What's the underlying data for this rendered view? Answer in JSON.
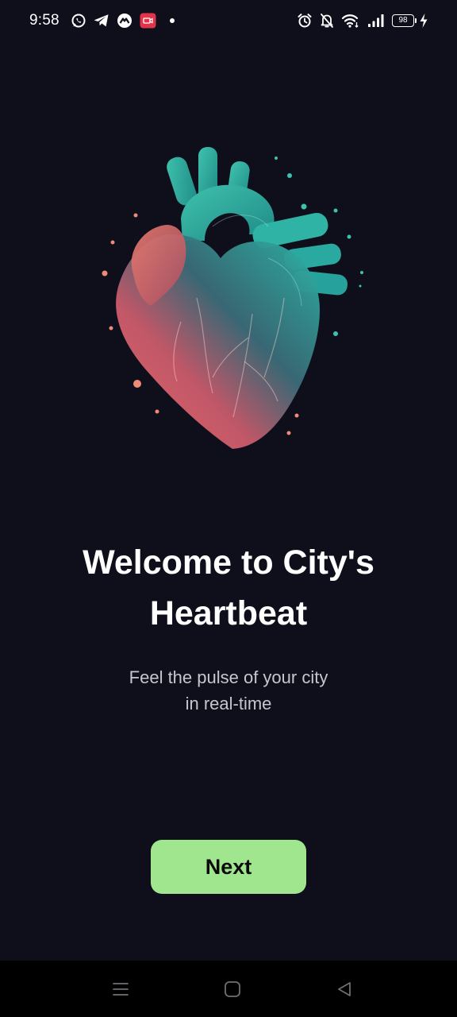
{
  "status_bar": {
    "time": "9:58",
    "battery_level": "98",
    "left_icons": [
      "whatsapp-icon",
      "telegram-icon",
      "game-icon",
      "screen-record-icon",
      "notification-dot-icon"
    ],
    "right_icons": [
      "alarm-icon",
      "silent-bell-icon",
      "wifi-icon",
      "signal-icon",
      "battery-icon",
      "charging-icon"
    ]
  },
  "hero": {
    "image": "anatomical-heart-illustration",
    "colors": {
      "teal": "#2bb7a6",
      "deep_teal": "#1b6f72",
      "coral": "#f2716d"
    }
  },
  "onboarding": {
    "title_line1": "Welcome to City's",
    "title_line2": "Heartbeat",
    "subtitle_line1": "Feel the pulse of your city",
    "subtitle_line2": "in real-time",
    "next_label": "Next"
  },
  "colors": {
    "background": "#0f0f1c",
    "button": "#a0e68f",
    "button_text": "#0b0b0b",
    "subtitle": "#c6c6cc"
  },
  "nav_bar": {
    "buttons": [
      "menu-icon",
      "home-icon",
      "back-icon"
    ]
  }
}
